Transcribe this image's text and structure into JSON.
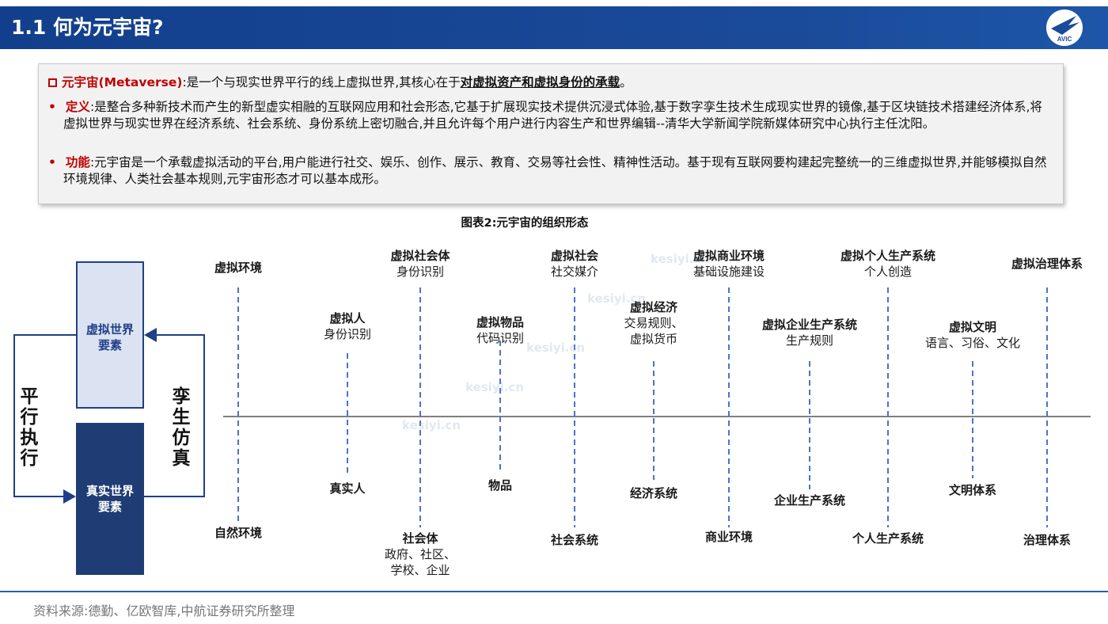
{
  "header": {
    "title": "1.1 何为元宇宙?",
    "logo_text": "AVIC"
  },
  "intro": {
    "term_label": "元宇宙(Metaverse)",
    "term_text_before": ":是一个与现实世界平行的线上虚拟世界,其核心在于",
    "term_emphasis": "对虚拟资产和虚拟身份的承载",
    "term_text_after": "。",
    "bullets": [
      {
        "marker": "•",
        "label": "定义",
        "text": ":是整合多种新技术而产生的新型虚实相融的互联网应用和社会形态,它基于扩展现实技术提供沉浸式体验,基于数字孪生技术生成现实世界的镜像,基于区块链技术搭建经济体系,将虚拟世界与现实世界在经济系统、社会系统、身份系统上密切融合,并且允许每个用户进行内容生产和世界编辑--清华大学新闻学院新媒体研究中心执行主任沈阳。"
      },
      {
        "marker": "•",
        "label": "功能",
        "text": ":元宇宙是一个承载虚拟活动的平台,用户能进行社交、娱乐、创作、展示、教育、交易等社会性、精神性活动。基于现有互联网要构建起完整统一的三维虚拟世界,并能够模拟自然环境规律、人类社会基本规则,元宇宙形态才可以基本成形。"
      }
    ]
  },
  "figure": {
    "title": "图表2:元宇宙的组织形态",
    "virtual_box": [
      "虚拟世界",
      "要素"
    ],
    "real_box": [
      "真实世界",
      "要素"
    ],
    "left_label": [
      "平",
      "行",
      "执",
      "行"
    ],
    "right_label": [
      "孪",
      "生",
      "仿",
      "真"
    ],
    "virtual_nodes": [
      {
        "name": "虚拟环境",
        "desc": ""
      },
      {
        "name": "虚拟人",
        "desc": "身份识别"
      },
      {
        "name": "虚拟社会体",
        "desc": "身份识别"
      },
      {
        "name": "虚拟物品",
        "desc": "代码识别"
      },
      {
        "name": "虚拟社会",
        "desc": "社交媒介"
      },
      {
        "name": "虚拟经济",
        "desc": "交易规则、虚拟货币"
      },
      {
        "name": "虚拟商业环境",
        "desc": "基础设施建设"
      },
      {
        "name": "虚拟企业生产系统",
        "desc": "生产规则"
      },
      {
        "name": "虚拟个人生产系统",
        "desc": "个人创造"
      },
      {
        "name": "虚拟文明",
        "desc": "语言、习俗、文化"
      },
      {
        "name": "虚拟治理体系",
        "desc": ""
      }
    ],
    "real_nodes": [
      {
        "name": "自然环境",
        "desc": ""
      },
      {
        "name": "真实人",
        "desc": ""
      },
      {
        "name": "社会体",
        "desc": "政府、社区、学校、企业"
      },
      {
        "name": "物品",
        "desc": ""
      },
      {
        "name": "社会系统",
        "desc": ""
      },
      {
        "name": "经济系统",
        "desc": ""
      },
      {
        "name": "商业环境",
        "desc": ""
      },
      {
        "name": "企业生产系统",
        "desc": ""
      },
      {
        "name": "个人生产系统",
        "desc": ""
      },
      {
        "name": "文明体系",
        "desc": ""
      },
      {
        "name": "治理体系",
        "desc": ""
      }
    ],
    "watermark": "kesiyi.cn",
    "colors": {
      "dash": "#4a74c9",
      "axis": "#555555",
      "arrow": "#1f3f87"
    }
  },
  "footer": {
    "source": "资料来源:德勤、亿欧智库,中航证券研究所整理"
  }
}
